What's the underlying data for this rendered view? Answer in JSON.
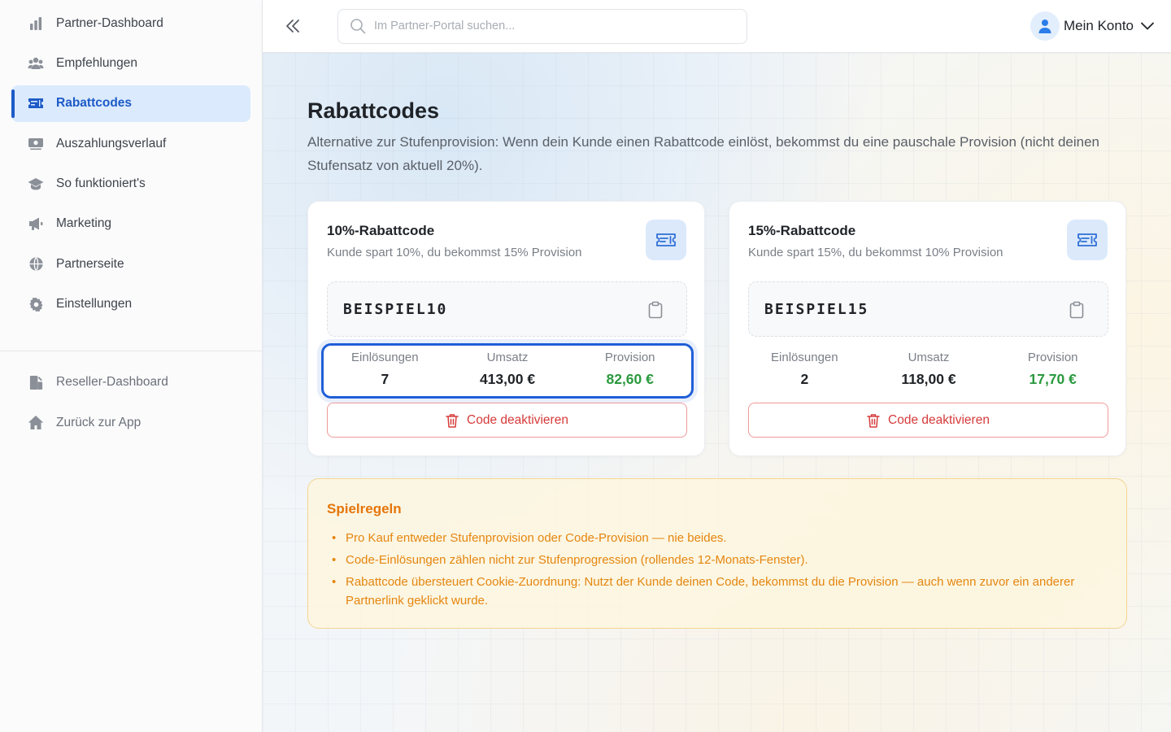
{
  "sidebar": {
    "items": [
      {
        "label": "Partner-Dashboard",
        "icon": "bar-chart-icon",
        "active": false
      },
      {
        "label": "Empfehlungen",
        "icon": "users-icon",
        "active": false
      },
      {
        "label": "Rabattcodes",
        "icon": "ticket-icon",
        "active": true
      },
      {
        "label": "Auszahlungsverlauf",
        "icon": "money-icon",
        "active": false
      },
      {
        "label": "So funktioniert's",
        "icon": "graduation-cap-icon",
        "active": false
      },
      {
        "label": "Marketing",
        "icon": "megaphone-icon",
        "active": false
      },
      {
        "label": "Partnerseite",
        "icon": "globe-icon",
        "active": false
      },
      {
        "label": "Einstellungen",
        "icon": "gear-icon",
        "active": false
      }
    ],
    "secondary": [
      {
        "label": "Reseller-Dashboard",
        "icon": "reseller-icon"
      },
      {
        "label": "Zurück zur App",
        "icon": "home-icon"
      }
    ]
  },
  "header": {
    "search_placeholder": "Im Partner-Portal suchen...",
    "account_label": "Mein Konto"
  },
  "main": {
    "title": "Rabattcodes",
    "description": "Alternative zur Stufenprovision: Wenn dein Kunde einen Rabattcode einlöst, bekommst du eine pauschale Provision (nicht deinen Stufensatz von aktuell 20%).",
    "cards": [
      {
        "title": "10%-Rabattcode",
        "subtitle": "Kunde spart 10%, du bekommst 15% Provision",
        "code": "BEISPIEL10",
        "stats": [
          {
            "label": "Einlösungen",
            "value": "7"
          },
          {
            "label": "Umsatz",
            "value": "413,00 €"
          },
          {
            "label": "Provision",
            "value": "82,60 €"
          }
        ],
        "button_label": "Code deaktivieren"
      },
      {
        "title": "15%-Rabattcode",
        "subtitle": "Kunde spart 15%, du bekommst 10% Provision",
        "code": "BEISPIEL15",
        "stats": [
          {
            "label": "Einlösungen",
            "value": "2"
          },
          {
            "label": "Umsatz",
            "value": "118,00 €"
          },
          {
            "label": "Provision",
            "value": "17,70 €"
          }
        ],
        "button_label": "Code deaktivieren"
      }
    ],
    "rules": {
      "title": "Spielregeln",
      "items": [
        "Pro Kauf entweder Stufenprovision oder Code-Provision — nie beides.",
        "Code-Einlösungen zählen nicht zur Stufenprogression (rollendes 12-Monats-Fenster).",
        "Rabattcode übersteuert Cookie-Zuordnung: Nutzt der Kunde deinen Code, bekommst du die Provision — auch wenn zuvor ein anderer Partnerlink geklickt wurde."
      ]
    }
  },
  "colors": {
    "accent": "#1d5bc7",
    "active_bg": "#dbeafd",
    "positive": "#2a9a3e",
    "danger": "#d63b3b",
    "warning": "#e5760b"
  }
}
